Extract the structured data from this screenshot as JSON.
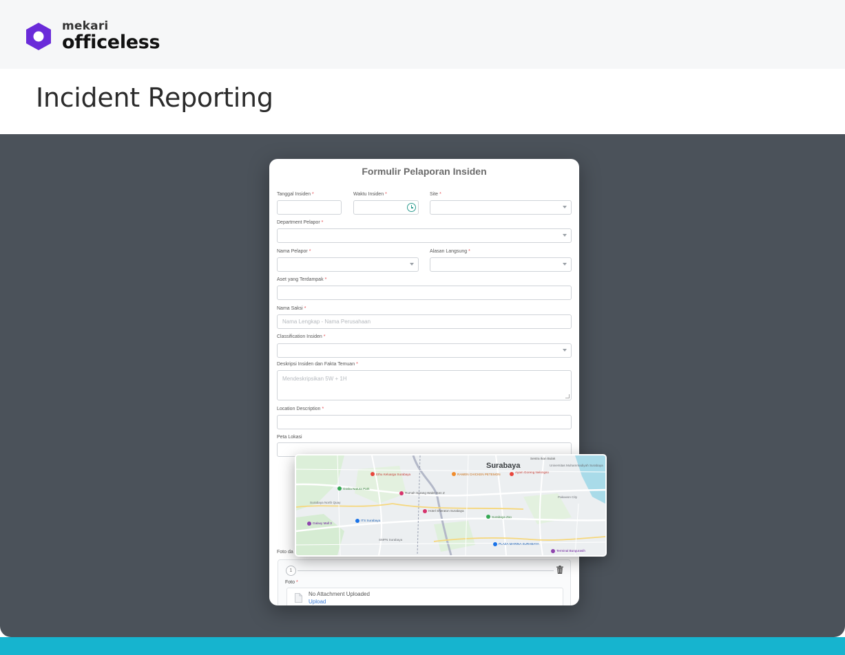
{
  "brand": {
    "top": "mekari",
    "name": "officeless",
    "color": "#6a2bd9"
  },
  "page": {
    "title": "Incident Reporting"
  },
  "colors": {
    "stage": "#4b525a",
    "accent_strip": "#16b4cf",
    "required": "#e5484d",
    "link": "#3a7bd5"
  },
  "form": {
    "title": "Formulir Pelaporan Insiden",
    "fields": {
      "tanggal": {
        "label": "Tanggal Insiden"
      },
      "waktu": {
        "label": "Waktu Insiden"
      },
      "site": {
        "label": "Site"
      },
      "department": {
        "label": "Department Pelapor"
      },
      "nama_pelapor": {
        "label": "Nama Pelapor"
      },
      "alasan": {
        "label": "Alasan Langsung"
      },
      "aset": {
        "label": "Aset yang Terdampak"
      },
      "saksi": {
        "label": "Nama Saksi",
        "placeholder": "Nama Lengkap - Nama Perusahaan"
      },
      "klasifikasi": {
        "label": "Classification Insiden"
      },
      "deskripsi": {
        "label": "Deskripsi Insiden dan Fakta Temuan",
        "placeholder": "Mendeskripsikan 5W + 1H"
      },
      "lokasi_desc": {
        "label": "Location Description"
      },
      "peta": {
        "label": "Peta Lokasi"
      }
    },
    "photo_section": {
      "label": "Foto da",
      "step": "1",
      "foto_label": "Foto",
      "empty_text": "No Attachment Uploaded",
      "upload_link": "Upload"
    }
  },
  "map": {
    "city": "Surabaya",
    "places": [
      "Sentra Ikan Bulak",
      "Universitas Muhammadiyah Surabaya",
      "Ethu Keluarga Surabaya",
      "RAMEN CHICKEN PETEMON",
      "Ayam Goreng Nelongso",
      "Graha Natura Park",
      "Rumah Sarang Walet Gen Z",
      "Surabaya North Quay",
      "Pakuwon City",
      "Surabaya Zoo",
      "Galaxy Mall 3",
      "ITS Surabaya",
      "Hotel Sheraton Surabaya",
      "SMPN Surabaya",
      "PLAZA MARINA SURABAYA",
      "Terminal Bungurasih"
    ]
  }
}
